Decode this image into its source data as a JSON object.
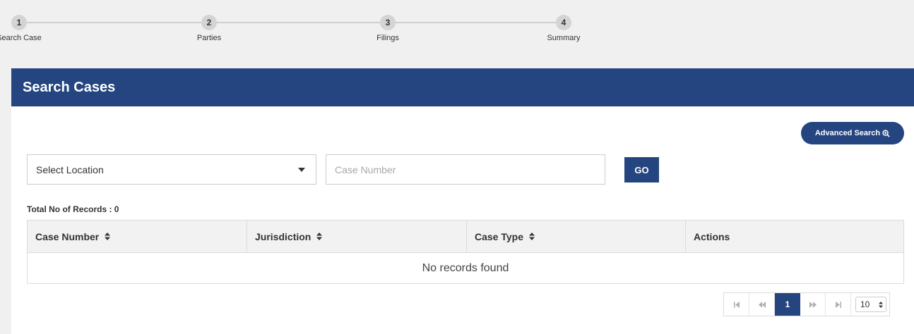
{
  "stepper": {
    "steps": [
      {
        "number": "1",
        "label": "Search Case"
      },
      {
        "number": "2",
        "label": "Parties"
      },
      {
        "number": "3",
        "label": "Filings"
      },
      {
        "number": "4",
        "label": "Summary"
      }
    ]
  },
  "panel": {
    "title": "Search Cases",
    "advanced_search_label": "Advanced Search",
    "location_select": {
      "selected": "Select Location"
    },
    "case_number": {
      "value": "",
      "placeholder": "Case Number"
    },
    "go_label": "GO",
    "total_records": "Total No of Records : 0"
  },
  "table": {
    "columns": [
      "Case Number",
      "Jurisdiction",
      "Case Type",
      "Actions"
    ],
    "empty_message": "No records found"
  },
  "pagination": {
    "current_page": "1",
    "page_size": "10"
  },
  "colors": {
    "primary": "#254580",
    "header_bg": "#f2f2f2",
    "border": "#dcdcdc"
  }
}
